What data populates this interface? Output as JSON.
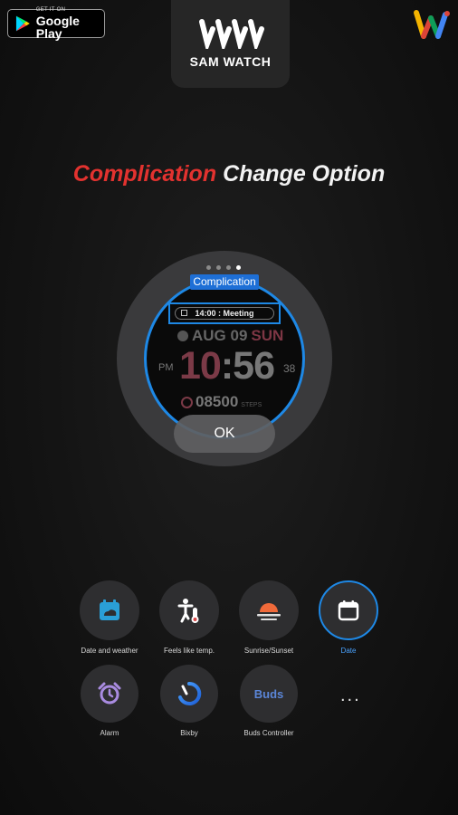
{
  "header": {
    "google_play": {
      "small": "GET IT ON",
      "big": "Google Play"
    },
    "logo_text": "SAM WATCH"
  },
  "headline": {
    "part1": "Complication",
    "part2": "Change Option"
  },
  "colors": {
    "accent_red": "#e2322f",
    "accent_blue": "#1e88e5",
    "face_red": "#7b3a47"
  },
  "watch": {
    "page_dots": {
      "count": 4,
      "active_index": 3
    },
    "complication_tag": "Complication",
    "meeting": "14:00 : Meeting",
    "date": {
      "month_day": "AUG 09",
      "weekday": "SUN"
    },
    "ampm": "PM",
    "hour": "10",
    "colon": ":",
    "minute": "56",
    "seconds": "38",
    "steps": "08500",
    "steps_label": "STEPS",
    "ok_label": "OK"
  },
  "complications": [
    {
      "label": "Date and weather",
      "icon": "calendar-weather-icon",
      "selected": false
    },
    {
      "label": "Feels like temp.",
      "icon": "feels-like-temp-icon",
      "selected": false
    },
    {
      "label": "Sunrise/Sunset",
      "icon": "sunrise-sunset-icon",
      "selected": false
    },
    {
      "label": "Date",
      "icon": "calendar-icon",
      "selected": true
    },
    {
      "label": "Alarm",
      "icon": "alarm-clock-icon",
      "selected": false
    },
    {
      "label": "Bixby",
      "icon": "bixby-icon",
      "selected": false
    },
    {
      "label": "Buds Controller",
      "icon": "buds-icon",
      "icon_text": "Buds",
      "selected": false
    }
  ],
  "more_label": "..."
}
